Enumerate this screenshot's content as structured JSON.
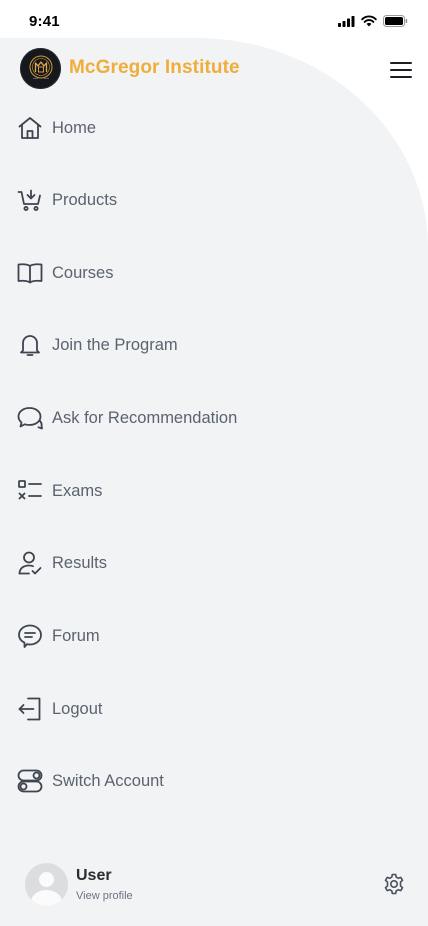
{
  "status_bar": {
    "time": "9:41"
  },
  "header": {
    "brand": "McGregor Institute"
  },
  "nav": {
    "items": [
      {
        "label": "Home",
        "icon": "home-icon"
      },
      {
        "label": "Products",
        "icon": "cart-icon"
      },
      {
        "label": "Courses",
        "icon": "book-icon"
      },
      {
        "label": "Join the Program",
        "icon": "bell-icon"
      },
      {
        "label": "Ask for Recommendation",
        "icon": "chat-bubbles-icon"
      },
      {
        "label": "Exams",
        "icon": "checklist-icon"
      },
      {
        "label": "Results",
        "icon": "user-check-icon"
      },
      {
        "label": "Forum",
        "icon": "message-icon"
      },
      {
        "label": "Logout",
        "icon": "logout-icon"
      },
      {
        "label": "Switch Account",
        "icon": "toggle-icon"
      }
    ]
  },
  "profile": {
    "name": "User",
    "link": "View profile"
  },
  "colors": {
    "brand": "#efae3a",
    "drawer_bg": "#f2f3f5",
    "nav_text": "#5b6370"
  }
}
